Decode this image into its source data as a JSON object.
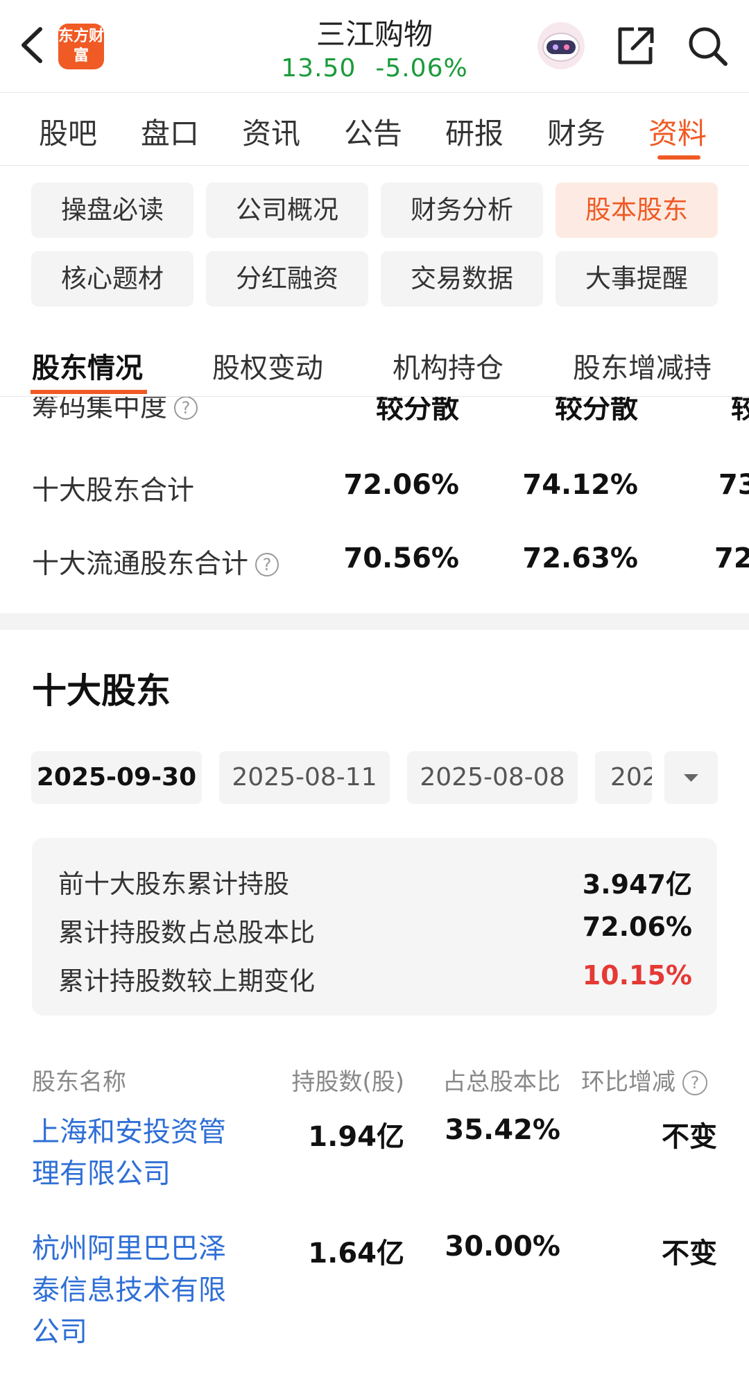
{
  "header": {
    "logo_text": "东方财富",
    "stock_name": "三江购物",
    "price": "13.50",
    "change": "-5.06%"
  },
  "icons": [
    "back-icon",
    "robot-icon",
    "share-icon",
    "search-icon",
    "question-icon",
    "dropdown-caret-icon"
  ],
  "colors": {
    "accent": "#f05a24",
    "down": "#1a9b3a",
    "up": "#e53935",
    "link": "#2f6fd6"
  },
  "main_tabs": [
    "股吧",
    "盘口",
    "资讯",
    "公告",
    "研报",
    "财务",
    "资料"
  ],
  "main_tab_active": "资料",
  "sub_nav": [
    "操盘必读",
    "公司概况",
    "财务分析",
    "股本股东",
    "核心题材",
    "分红融资",
    "交易数据",
    "大事提醒"
  ],
  "sub_nav_active": "股本股东",
  "section_tabs": [
    "股东情况",
    "股权变动",
    "机构持仓",
    "股东增减持"
  ],
  "section_tab_active": "股东情况",
  "concentration": {
    "label": "筹码集中度",
    "values": [
      "较分散",
      "较分散",
      "较"
    ]
  },
  "top10_total": {
    "label": "十大股东合计",
    "values": [
      "72.06%",
      "74.12%",
      "73"
    ]
  },
  "top10_float_total": {
    "label": "十大流通股东合计",
    "values": [
      "70.56%",
      "72.63%",
      "72"
    ]
  },
  "top10": {
    "title": "十大股东",
    "dates": [
      "2025-09-30",
      "2025-08-11",
      "2025-08-08",
      "202"
    ],
    "active_date": "2025-09-30",
    "summary": [
      {
        "label": "前十大股东累计持股",
        "value": "3.947亿"
      },
      {
        "label": "累计持股数占总股本比",
        "value": "72.06%"
      },
      {
        "label": "累计持股数较上期变化",
        "value": "10.15%"
      }
    ],
    "columns": [
      "股东名称",
      "持股数(股)",
      "占总股本比",
      "环比增减"
    ],
    "rows": [
      {
        "name_line1": "上海和安投资管",
        "name_line2": "理有限公司",
        "name_line3": "",
        "shares": "1.94亿",
        "ratio": "35.42%",
        "change": "不变"
      },
      {
        "name_line1": "杭州阿里巴巴泽",
        "name_line2": "泰信息技术有限",
        "name_line3": "公司",
        "shares": "1.64亿",
        "ratio": "30.00%",
        "change": "不变"
      }
    ]
  }
}
